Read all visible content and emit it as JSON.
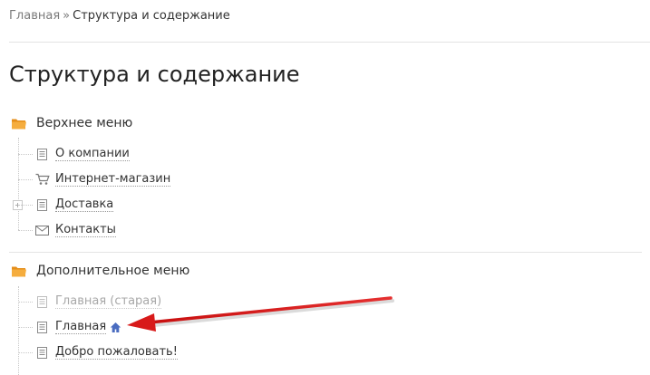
{
  "breadcrumb": {
    "home": "Главная",
    "separator": "»",
    "current": "Структура и содержание"
  },
  "page_title": "Структура и содержание",
  "menus": [
    {
      "label": "Верхнее меню",
      "items": [
        {
          "label": "О компании",
          "icon": "page-icon"
        },
        {
          "label": "Интернет-магазин",
          "icon": "cart-icon"
        },
        {
          "label": "Доставка",
          "icon": "page-icon",
          "expandable": true
        },
        {
          "label": "Контакты",
          "icon": "envelope-icon"
        }
      ]
    },
    {
      "label": "Дополнительное меню",
      "items": [
        {
          "label": "Главная (старая)",
          "icon": "page-icon",
          "inactive": true
        },
        {
          "label": "Главная",
          "icon": "page-icon",
          "home": true
        },
        {
          "label": "Добро пожаловать!",
          "icon": "page-icon"
        }
      ]
    }
  ],
  "colors": {
    "folder": "#f0a030",
    "home_icon": "#4a6cc0",
    "annotation_arrow": "#d81a1a"
  }
}
